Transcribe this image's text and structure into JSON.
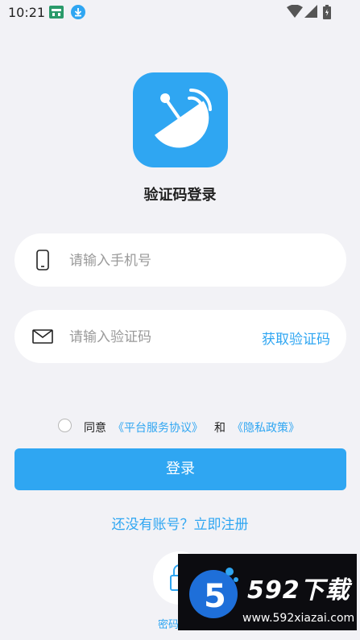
{
  "status_bar": {
    "time": "10:21",
    "icons": [
      "notification-app-icon",
      "download-icon",
      "wifi-icon",
      "cellular-signal-icon",
      "battery-icon"
    ]
  },
  "app": {
    "logo_icon": "satellite-dish-icon",
    "brand_color": "#2fa6f2"
  },
  "title": "验证码登录",
  "phone_field": {
    "icon": "phone-icon",
    "placeholder": "请输入手机号",
    "value": ""
  },
  "code_field": {
    "icon": "envelope-icon",
    "placeholder": "请输入验证码",
    "value": "",
    "get_code_label": "获取验证码"
  },
  "agreement": {
    "checked": false,
    "agree": "同意",
    "terms_link": "《平台服务协议》",
    "and": "和",
    "privacy_link": "《隐私政策》"
  },
  "login_button": "登录",
  "register_link": "还没有账号？立即注册",
  "alt_login": {
    "icon": "lock-icon",
    "label": "密码"
  },
  "watermark": {
    "brand": "592下载",
    "url": "www.592xiazai.com"
  }
}
